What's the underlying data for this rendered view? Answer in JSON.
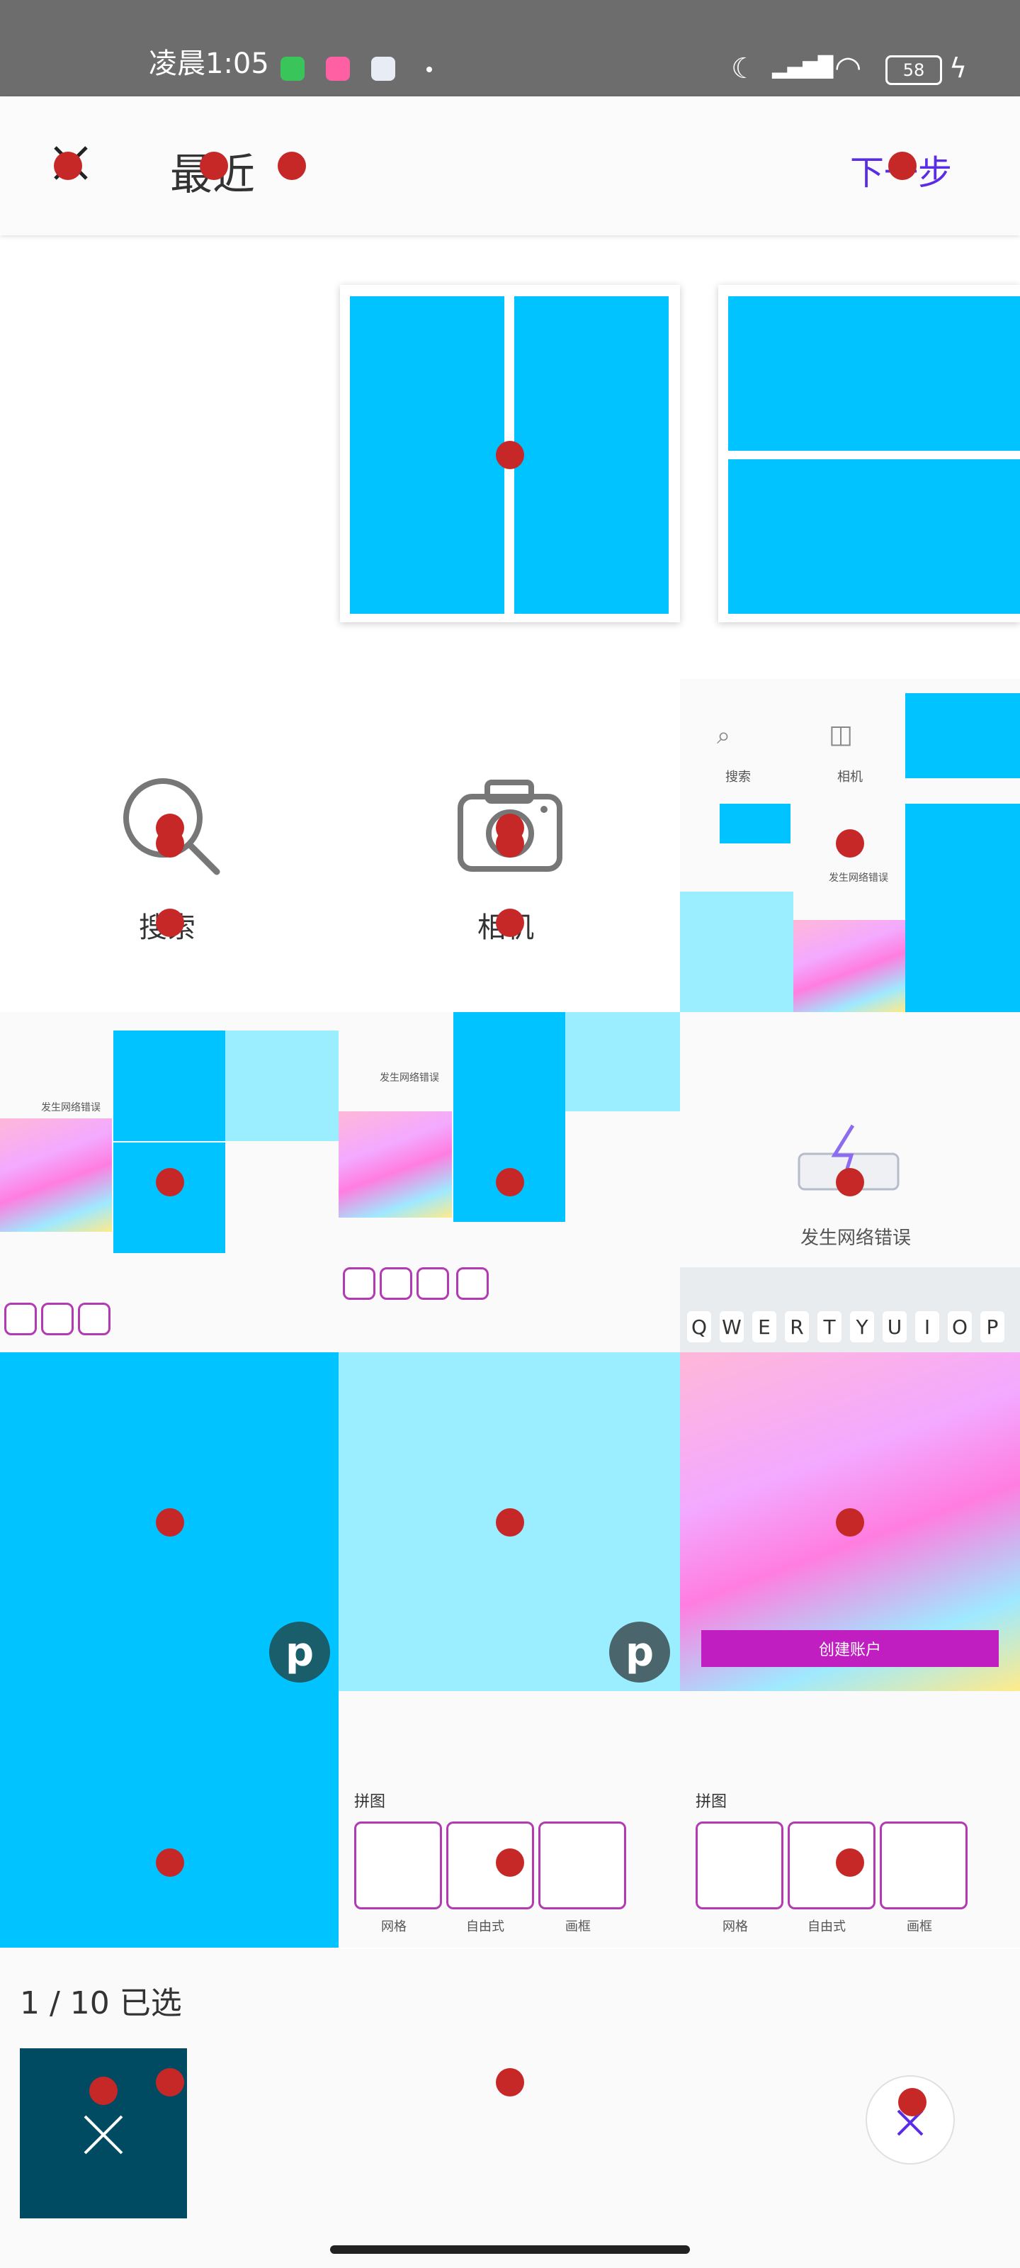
{
  "status_bar": {
    "time": "凌晨1:05",
    "battery": "58",
    "notification_icons": [
      "android-robot-icon",
      "bilibili-icon",
      "app-logo-icon",
      "dot-icon"
    ],
    "system_icons": [
      "moon-icon",
      "hd-signal-icon",
      "wifi-icon",
      "battery-icon",
      "charging-icon"
    ]
  },
  "header": {
    "close_icon": "close-icon",
    "title": "最近",
    "next": "下一步"
  },
  "quick_actions": {
    "search": "搜索",
    "camera": "相机"
  },
  "thumb_texts": {
    "search": "搜索",
    "camera": "相机",
    "network_error_small": "发生网络错误",
    "network_error": "发生网络错误",
    "create_account": "创建账户",
    "collage": "拼图",
    "grid": "网格",
    "free": "自由式",
    "frame": "画框",
    "keyboard_row": "QWERTYUIOP"
  },
  "selection": {
    "count_text": "1 / 10 已选"
  },
  "colors": {
    "accent": "#5b2ce6",
    "tile_blue": "#00c3ff",
    "tile_lightblue": "#9aeeff",
    "thumb_dark": "#004a62",
    "marker_red": "#c62828"
  }
}
